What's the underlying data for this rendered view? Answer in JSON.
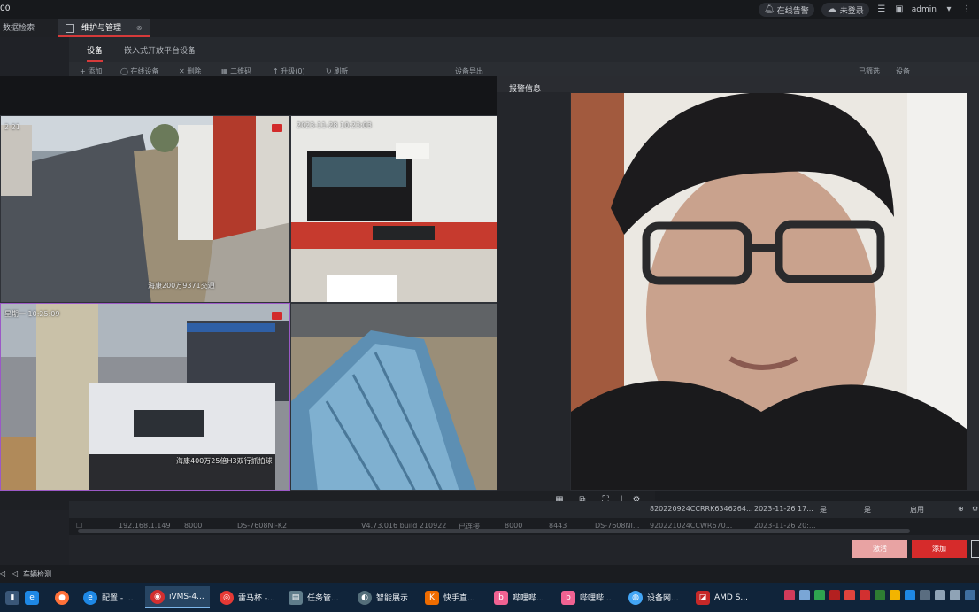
{
  "window": {
    "title": "00"
  },
  "header": {
    "online_alarm": "在线告警",
    "not_logged": "未登录",
    "user": "admin"
  },
  "modules": {
    "data_search": "数据检索",
    "maintenance": "维护与管理"
  },
  "subtabs": {
    "device": "设备",
    "embedded": "嵌入式开放平台设备"
  },
  "toolbar": {
    "add": "+ 添加",
    "online": "◯ 在线设备",
    "delete": "✕ 删除",
    "qr": "▦ 二维码",
    "upgrade": "↑ 升级(0)",
    "refresh": "↻ 刷新",
    "export": "设备导出",
    "filter_label": "已筛选",
    "filter_value": "设备"
  },
  "video": {
    "cell1_osd_time": "2 21",
    "cell1_osd_label": "海康200万9371交通",
    "cell2_osd_time": "2023-11-28 10:23:03",
    "cell3_osd_time": "星期一 10:25:09",
    "cell3_osd_label": "海康400万25倍H3双行抓拍球"
  },
  "alarm": {
    "title": "报警信息"
  },
  "table": {
    "row_top": {
      "serial": "820220924CCRRK6346264...",
      "time": "2023-11-26 17...",
      "c1": "是",
      "c2": "是",
      "status": "启用"
    },
    "row_main": {
      "ip": "192.168.1.149",
      "port": "8000",
      "model": "DS-7608NI-K2",
      "version": "V4.73.016 build 210922",
      "connected": "已连接",
      "port2": "8000",
      "extra": "8443",
      "model2": "DS-7608NI...",
      "serial": "920221024CCWR670...",
      "time": "2023-11-26 20:..."
    }
  },
  "actions": {
    "activate": "激活",
    "add": "添加"
  },
  "status_bar": {
    "vehicle_detect": "车辆检测"
  },
  "taskbar": [
    {
      "label": "配置 - ...",
      "color": "#1e88e5"
    },
    {
      "label": "iVMS-4...",
      "color": "#d32f2f"
    },
    {
      "label": "雷马杯 -...",
      "color": "#e53935"
    },
    {
      "label": "任务管...",
      "color": "#607d8b"
    },
    {
      "label": "智能展示",
      "color": "#546e7a"
    },
    {
      "label": "快手直...",
      "color": "#ef6c00"
    },
    {
      "label": "哔哩哔...",
      "color": "#f06292"
    },
    {
      "label": "哔哩哔...",
      "color": "#f06292"
    },
    {
      "label": "设备网...",
      "color": "#42a5f5"
    },
    {
      "label": "AMD S...",
      "color": "#c62828"
    }
  ]
}
